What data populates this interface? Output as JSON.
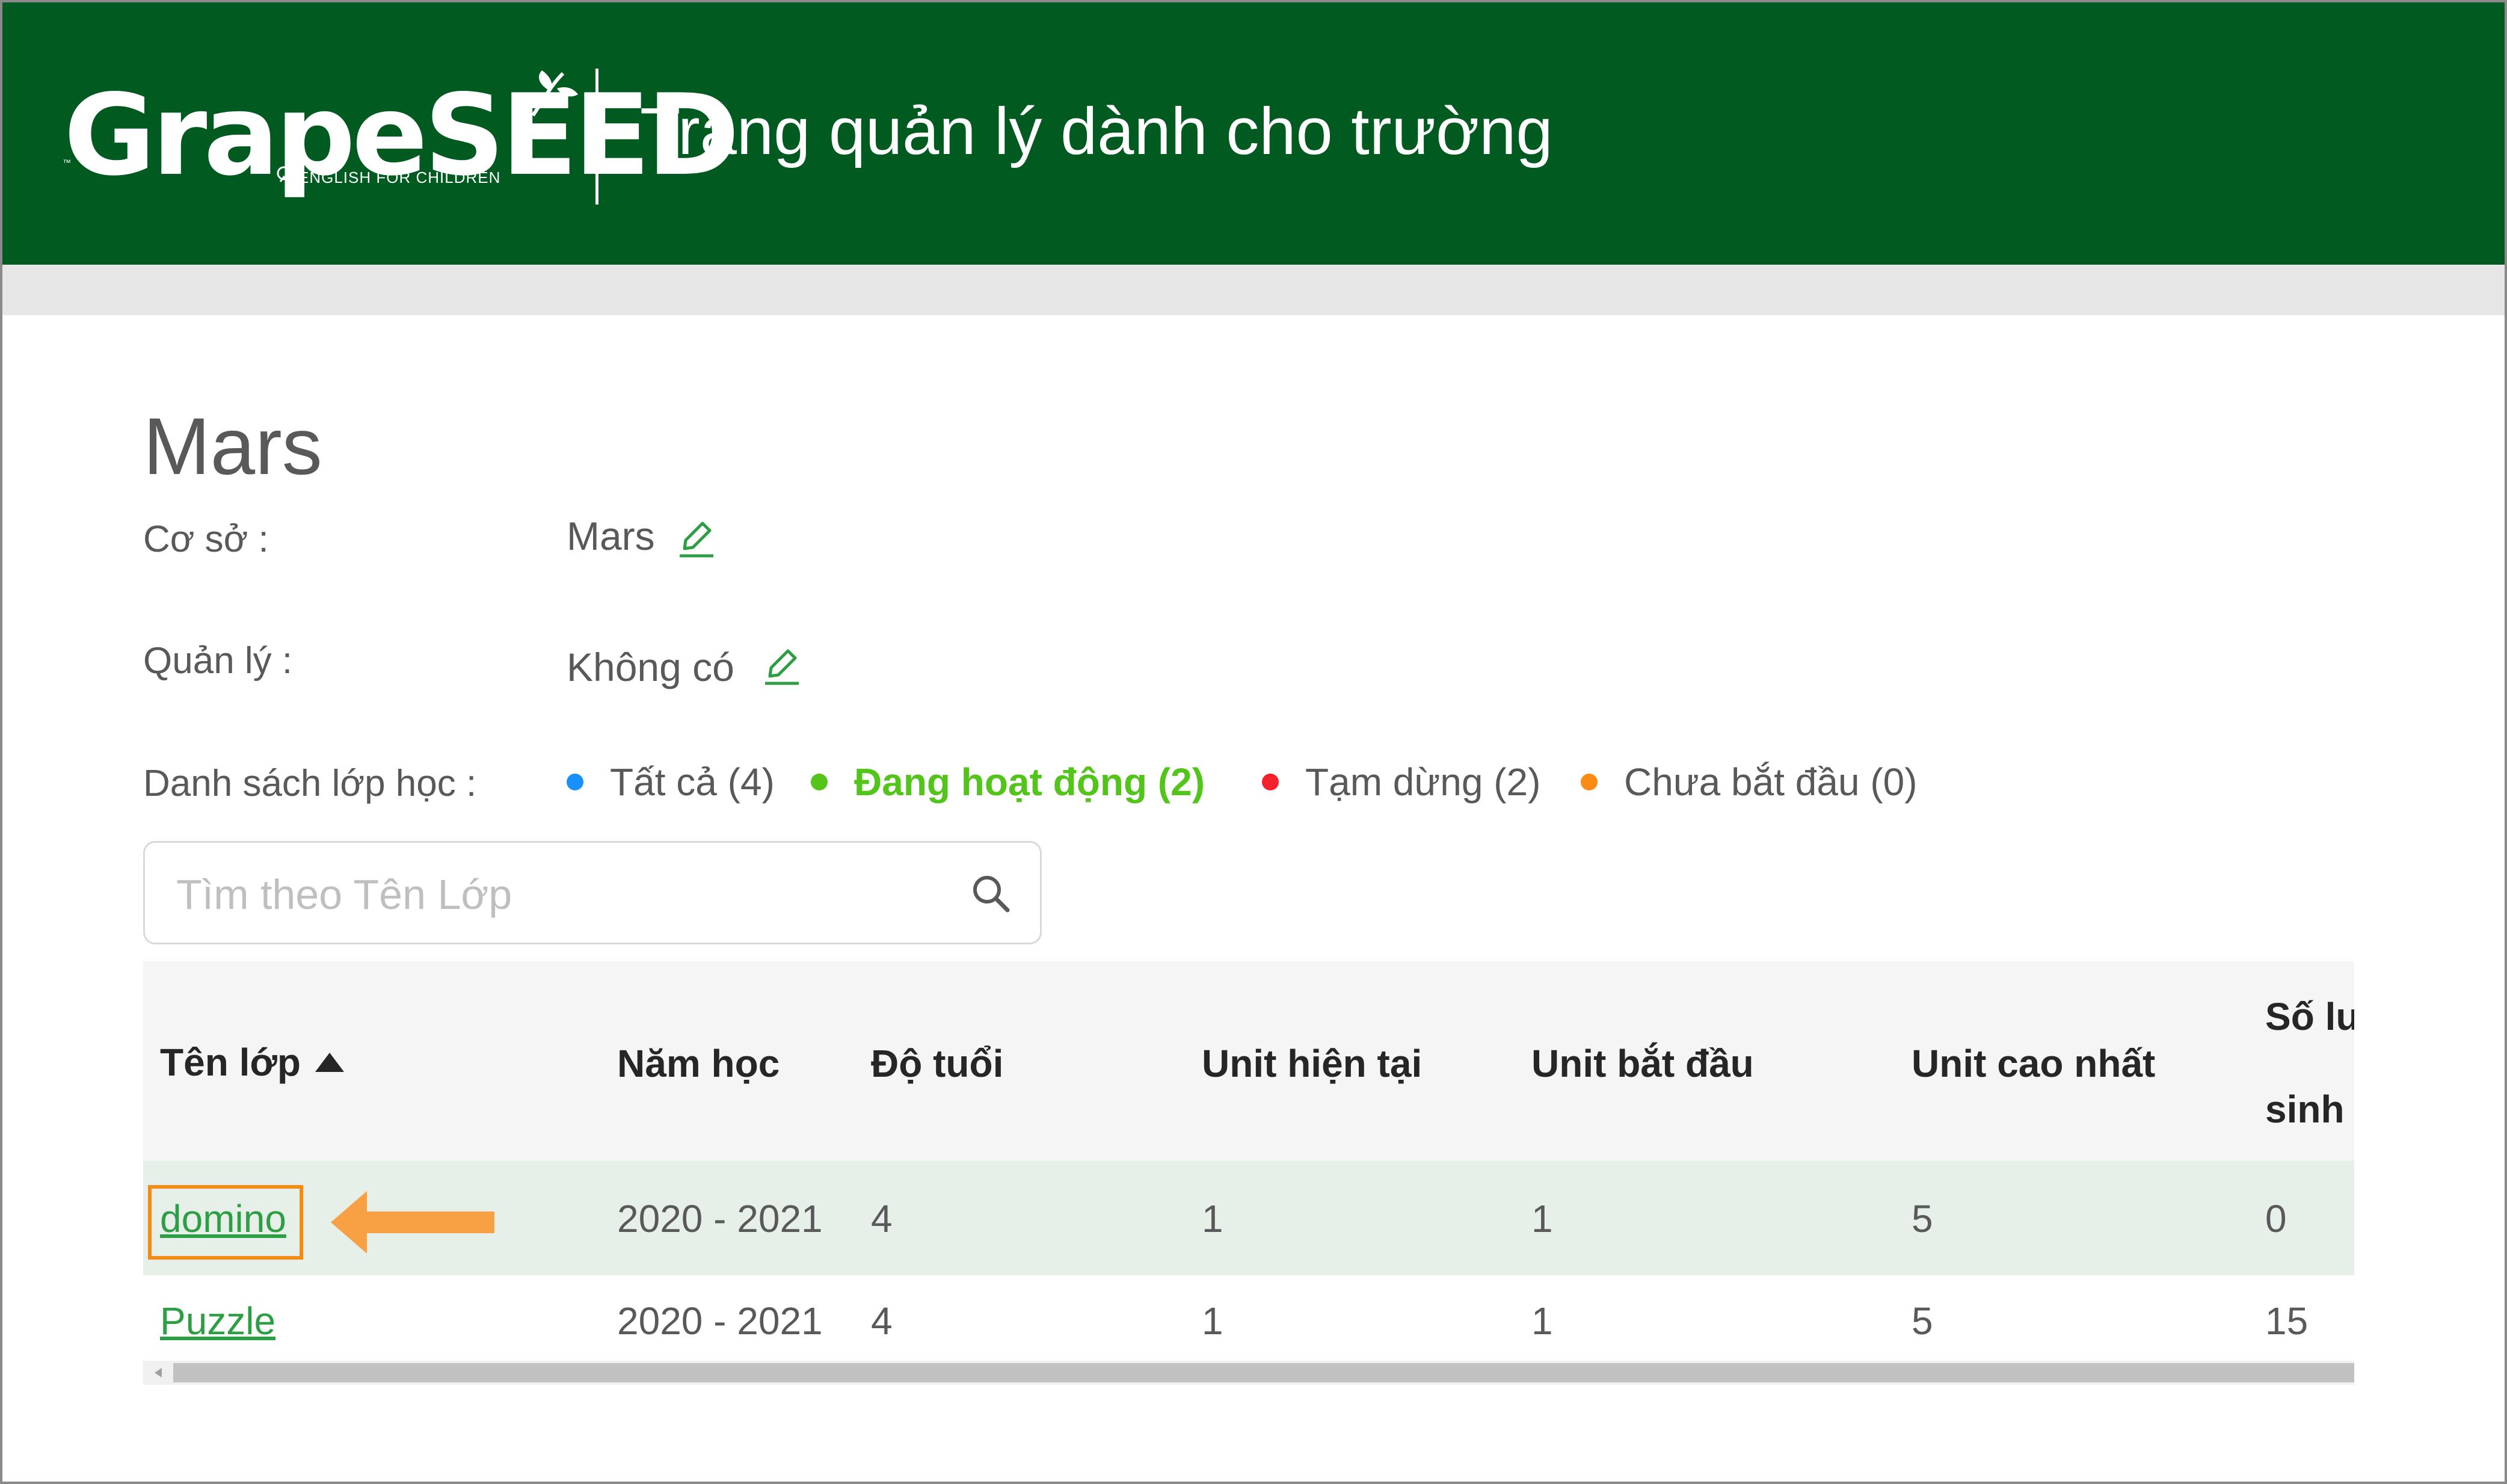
{
  "header": {
    "logo_text": "GrapeSEED",
    "logo_subtitle": "ENGLISH FOR CHILDREN",
    "logo_tm": "™",
    "app_title": "Trang quản lý dành cho trường"
  },
  "school": {
    "title": "Mars",
    "campus_label": "Cơ sở :",
    "campus_value": "Mars",
    "manager_label": "Quản lý :",
    "manager_value": "Không có"
  },
  "class_filter": {
    "label": "Danh sách lớp học :",
    "items": [
      {
        "text": "Tất cả (4)",
        "color": "#1890ff",
        "active": false
      },
      {
        "text": "Đang hoạt động (2)",
        "color": "#52c41a",
        "active": true
      },
      {
        "text": "Tạm dừng (2)",
        "color": "#f5222d",
        "active": false
      },
      {
        "text": "Chưa bắt đầu (0)",
        "color": "#fa8c16",
        "active": false
      }
    ]
  },
  "search": {
    "placeholder": "Tìm theo Tên Lớp",
    "value": "",
    "icon": "search-icon"
  },
  "table": {
    "columns": [
      "Tên lớp",
      "Năm học",
      "Độ tuổi",
      "Unit hiện tại",
      "Unit bắt đầu",
      "Unit cao nhất",
      "Số lu",
      "sinh"
    ],
    "sort_indicator": "ascending",
    "rows": [
      {
        "name": "domino",
        "year": "2020 - 2021",
        "age": "4",
        "current_unit": "1",
        "start_unit": "1",
        "max_unit": "5",
        "students": "0"
      },
      {
        "name": "Puzzle",
        "year": "2020 - 2021",
        "age": "4",
        "current_unit": "1",
        "start_unit": "1",
        "max_unit": "5",
        "students": "15"
      }
    ]
  },
  "colors": {
    "header_green": "#015a1f",
    "link_green": "#2e9e44",
    "highlight_orange": "#f28c18",
    "row_highlight": "#e6efe8"
  }
}
